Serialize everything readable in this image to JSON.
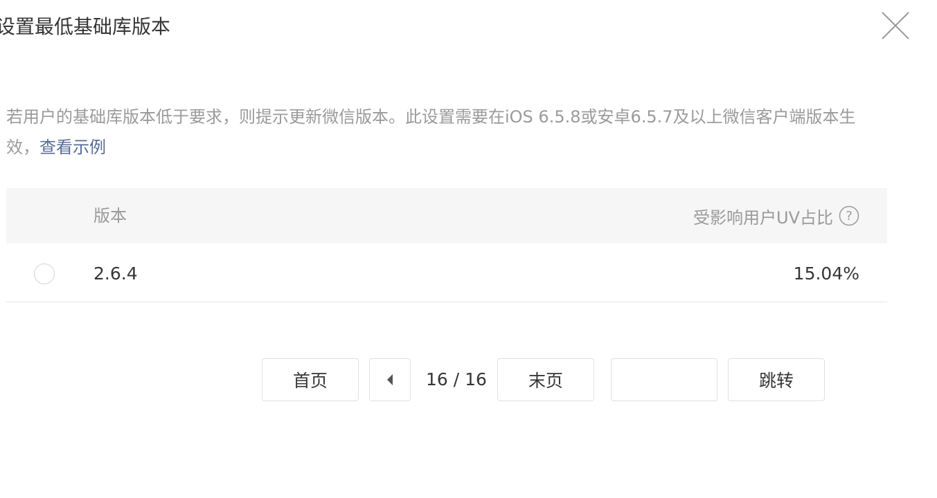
{
  "dialog": {
    "title": "设置最低基础库版本",
    "close_icon": "close-icon"
  },
  "description": {
    "text": "若用户的基础库版本低于要求，则提示更新微信版本。此设置需要在iOS 6.5.8或安卓6.5.7及以上微信客户端版本生效，",
    "link_label": "查看示例"
  },
  "table": {
    "columns": {
      "version": "版本",
      "uv": "受影响用户UV占比"
    },
    "help_icon": "question-circle-icon",
    "rows": [
      {
        "version": "2.6.4",
        "uv": "15.04%",
        "selected": false
      }
    ]
  },
  "pagination": {
    "first_label": "首页",
    "prev_icon": "caret-left-icon",
    "page_indicator": "16 / 16",
    "last_label": "末页",
    "jump_input_value": "",
    "jump_label": "跳转"
  },
  "colors": {
    "link": "#576b95",
    "muted_text": "#9a9a9a",
    "header_bg": "#f6f6f6"
  }
}
